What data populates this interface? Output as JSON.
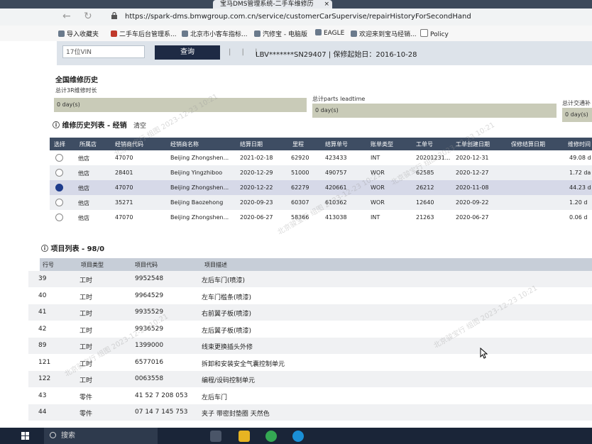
{
  "browser": {
    "tab_title": "宝马DMS管理系统-二手车维修历",
    "url": "https://spark-dms.bmwgroup.com.cn/service/customerCarSupervise/repairHistoryForSecondHand",
    "bookmarks": [
      "导入收藏夹",
      "二手车后台管理系...",
      "北京市小客车指标...",
      "汽修宝 - 电脑版",
      "EAGLE",
      "欢迎来到宝马经销...",
      "Policy"
    ]
  },
  "search": {
    "vin_placeholder": "17位VIN",
    "query_label": "查询",
    "separators": "| | |",
    "vin_info": "LBV*******SN29407  |  保修起始日：2016-10-28"
  },
  "summary": {
    "section_title": "全国维修历史",
    "label_3r": "总计3R维修时长",
    "value_3r": "0 day(s)",
    "label_parts": "总计parts leadtime",
    "value_parts": "0 day(s)",
    "label_delivery": "总计交通补助",
    "value_delivery": "0 day(s)"
  },
  "history": {
    "title": "维修历史列表 - 经销",
    "clear_label": "清空",
    "columns": [
      "选择",
      "所属店",
      "经销商代码",
      "经销商名称",
      "结算日期",
      "里程",
      "结算单号",
      "账单类型",
      "工单号",
      "工单创建日期",
      "保修结算日期",
      "维修时间"
    ],
    "rows": [
      {
        "store": "他店",
        "code": "47070",
        "name": "Beijing Zhongshen...",
        "date": "2021-02-18",
        "mileage": "62920",
        "bill": "423433",
        "type": "INT",
        "order": "20201231...",
        "created": "2020-12-31",
        "warranty": "",
        "time": "49.08 d"
      },
      {
        "store": "他店",
        "code": "28401",
        "name": "Beijing Yingzhiboo",
        "date": "2020-12-29",
        "mileage": "51000",
        "bill": "490757",
        "type": "WOR",
        "order": "62585",
        "created": "2020-12-27",
        "warranty": "",
        "time": "1.72 da"
      },
      {
        "store": "他店",
        "code": "47070",
        "name": "Beijing Zhongshen...",
        "date": "2020-12-22",
        "mileage": "62279",
        "bill": "420661",
        "type": "WOR",
        "order": "26212",
        "created": "2020-11-08",
        "warranty": "",
        "time": "44.23 d"
      },
      {
        "store": "他店",
        "code": "35271",
        "name": "Beijing Baozehong",
        "date": "2020-09-23",
        "mileage": "60307",
        "bill": "610362",
        "type": "WOR",
        "order": "12640",
        "created": "2020-09-22",
        "warranty": "",
        "time": "1.20 d"
      },
      {
        "store": "他店",
        "code": "47070",
        "name": "Beijing Zhongshen...",
        "date": "2020-06-27",
        "mileage": "58366",
        "bill": "413038",
        "type": "INT",
        "order": "21263",
        "created": "2020-06-27",
        "warranty": "",
        "time": "0.06 d"
      }
    ]
  },
  "items": {
    "title": "项目列表 - 98/0",
    "columns": [
      "行号",
      "项目类型",
      "项目代码",
      "项目描述"
    ],
    "rows": [
      {
        "no": "39",
        "type": "工时",
        "code": "9952548",
        "desc": "左后车门(喷漆)"
      },
      {
        "no": "40",
        "type": "工时",
        "code": "9964529",
        "desc": "左车门槛条(喷漆)"
      },
      {
        "no": "41",
        "type": "工时",
        "code": "9935529",
        "desc": "右前翼子板(喷漆)"
      },
      {
        "no": "42",
        "type": "工时",
        "code": "9936529",
        "desc": "左后翼子板(喷漆)"
      },
      {
        "no": "89",
        "type": "工时",
        "code": "1399000",
        "desc": "线束更换插头外修"
      },
      {
        "no": "121",
        "type": "工时",
        "code": "6577016",
        "desc": "拆卸和安装安全气囊控制单元"
      },
      {
        "no": "122",
        "type": "工时",
        "code": "0063558",
        "desc": "编程/设码控制单元"
      },
      {
        "no": "43",
        "type": "零件",
        "code": "41 52 7 208 053",
        "desc": "左后车门"
      },
      {
        "no": "44",
        "type": "零件",
        "code": "07 14 7 145 753",
        "desc": "夹子 带密封垫圈 天然色"
      }
    ]
  },
  "watermark": "北京骏宝行 组图 2023-12-23 10:21",
  "taskbar": {
    "search_label": "搜索"
  }
}
